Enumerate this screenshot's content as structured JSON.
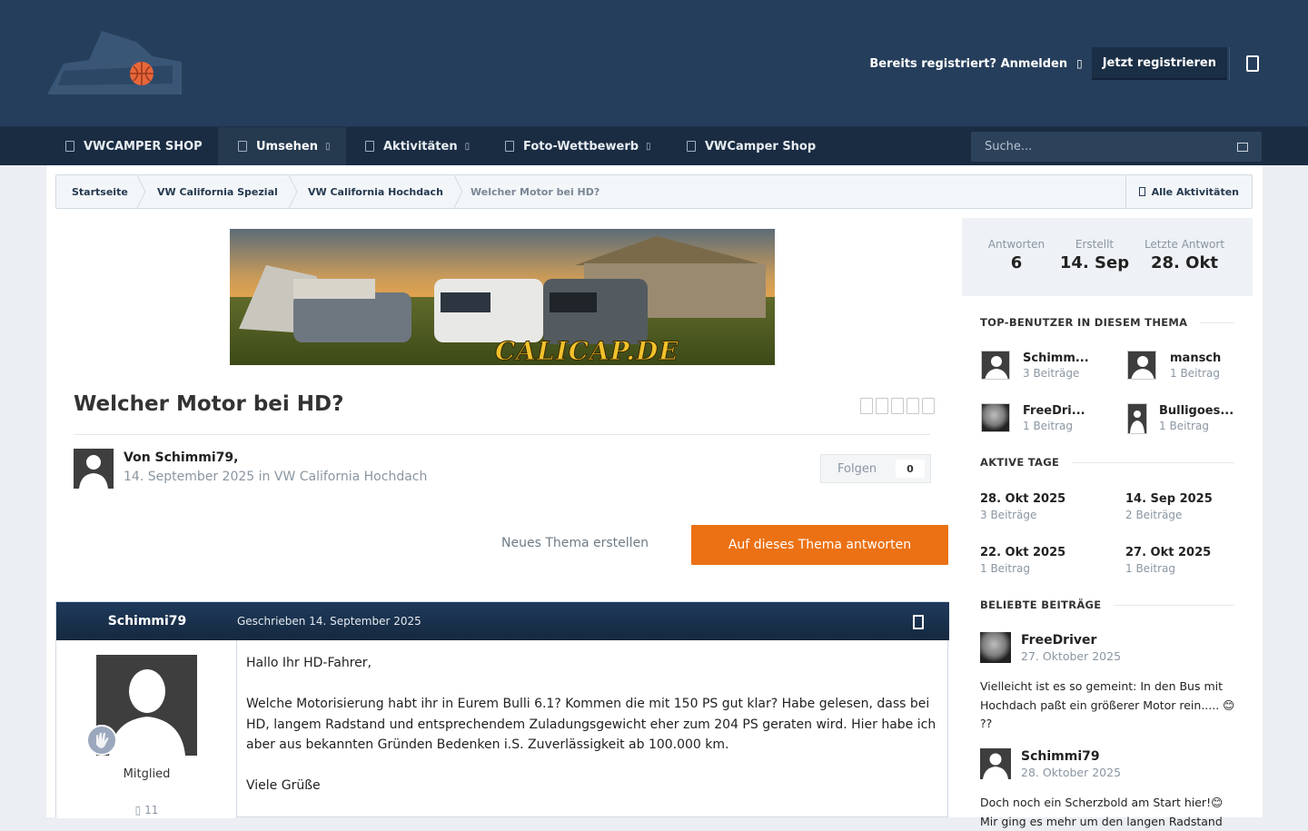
{
  "header": {
    "signin_label": "Bereits registriert? Anmelden",
    "register_label": "Jetzt registrieren"
  },
  "nav": {
    "items": [
      {
        "label": "VWCAMPER SHOP"
      },
      {
        "label": "Umsehen"
      },
      {
        "label": "Aktivitäten"
      },
      {
        "label": "Foto-Wettbewerb"
      },
      {
        "label": "VWCamper Shop"
      }
    ],
    "active_index": 1
  },
  "search": {
    "placeholder": "Suche..."
  },
  "breadcrumb": {
    "items": [
      "Startseite",
      "VW California Spezial",
      "VW California Hochdach",
      "Welcher Motor bei HD?"
    ],
    "all_activity": "Alle Aktivitäten"
  },
  "banner": {
    "text": "CALICAP.DE"
  },
  "thread": {
    "title": "Welcher Motor bei HD?",
    "author_line": "Von Schimmi79,",
    "date": "14. September 2025",
    "in_word": "in",
    "forum": "VW California Hochdach",
    "follow_label": "Folgen",
    "follow_count": "0",
    "new_topic_label": "Neues Thema erstellen",
    "reply_label": "Auf dieses Thema antworten"
  },
  "post": {
    "author": "Schimmi79",
    "written": "Geschrieben 14. September 2025",
    "rank": "Mitglied",
    "post_count": "11",
    "body": [
      "Hallo Ihr HD-Fahrer,",
      "Welche Motorisierung habt ihr in Eurem Bulli 6.1? Kommen die mit 150 PS gut klar? Habe gelesen, dass bei HD, langem Radstand  und entsprechendem Zuladungsgewicht eher zum 204 PS geraten wird. Hier habe ich aber aus bekannten Gründen Bedenken i.S. Zuverlässigkeit ab 100.000 km.",
      "Viele Grüße"
    ]
  },
  "stats": [
    {
      "label": "Antworten",
      "value": "6"
    },
    {
      "label": "Erstellt",
      "value": "14. Sep"
    },
    {
      "label": "Letzte Antwort",
      "value": "28. Okt"
    }
  ],
  "top_users": {
    "heading": "TOP-BENUTZER IN DIESEM THEMA",
    "users": [
      {
        "name": "Schimm...",
        "posts": "3 Beiträge"
      },
      {
        "name": "mansch",
        "posts": "1 Beitrag"
      },
      {
        "name": "FreeDri...",
        "posts": "1 Beitrag"
      },
      {
        "name": "Bulligoes...",
        "posts": "1 Beitrag"
      }
    ]
  },
  "active_days": {
    "heading": "AKTIVE TAGE",
    "days": [
      {
        "date": "28. Okt 2025",
        "count": "3 Beiträge"
      },
      {
        "date": "14. Sep 2025",
        "count": "2 Beiträge"
      },
      {
        "date": "22. Okt 2025",
        "count": "1 Beitrag"
      },
      {
        "date": "27. Okt 2025",
        "count": "1 Beitrag"
      }
    ]
  },
  "popular_posts": {
    "heading": "BELIEBTE BEITRÄGE",
    "posts": [
      {
        "author": "FreeDriver",
        "date": "27. Oktober 2025",
        "text": "Vielleicht ist es so gemeint: In den Bus mit Hochdach paßt ein größerer Motor rein..... 😊 ??"
      },
      {
        "author": "Schimmi79",
        "date": "28. Oktober 2025",
        "text": "Doch noch ein Scherzbold am Start hier!😊 Mir ging es mehr um den langen Radstand"
      }
    ]
  }
}
